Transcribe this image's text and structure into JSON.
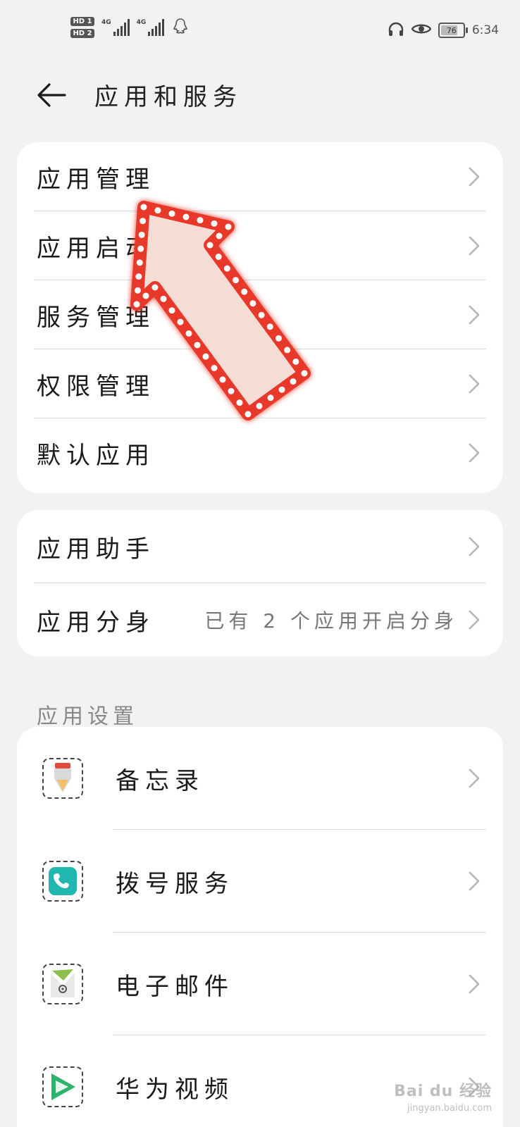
{
  "status_bar": {
    "hd1": "HD 1",
    "hd2": "HD 2",
    "net1": "4G",
    "net2": "4G",
    "battery": "76",
    "battery_level": 0.76,
    "time": "6:34"
  },
  "header": {
    "title": "应用和服务"
  },
  "card1": {
    "items": [
      {
        "label": "应用管理"
      },
      {
        "label": "应用启动管理"
      },
      {
        "label": "服务管理"
      },
      {
        "label": "权限管理"
      },
      {
        "label": "默认应用"
      }
    ]
  },
  "card2": {
    "items": [
      {
        "label": "应用助手",
        "subtext": ""
      },
      {
        "label": "应用分身",
        "subtext": "已有 2 个应用开启分身"
      }
    ]
  },
  "section": {
    "title": "应用设置"
  },
  "apps": [
    {
      "label": "备忘录",
      "icon": "memo-icon"
    },
    {
      "label": "拨号服务",
      "icon": "phone-icon"
    },
    {
      "label": "电子邮件",
      "icon": "email-icon"
    },
    {
      "label": "华为视频",
      "icon": "video-icon"
    }
  ],
  "watermark": {
    "text": "Bai du 经验",
    "url": "jingyan.baidu.com"
  },
  "colors": {
    "background": "#f1f2f4",
    "card": "#ffffff",
    "arrow": "#e8392a"
  }
}
